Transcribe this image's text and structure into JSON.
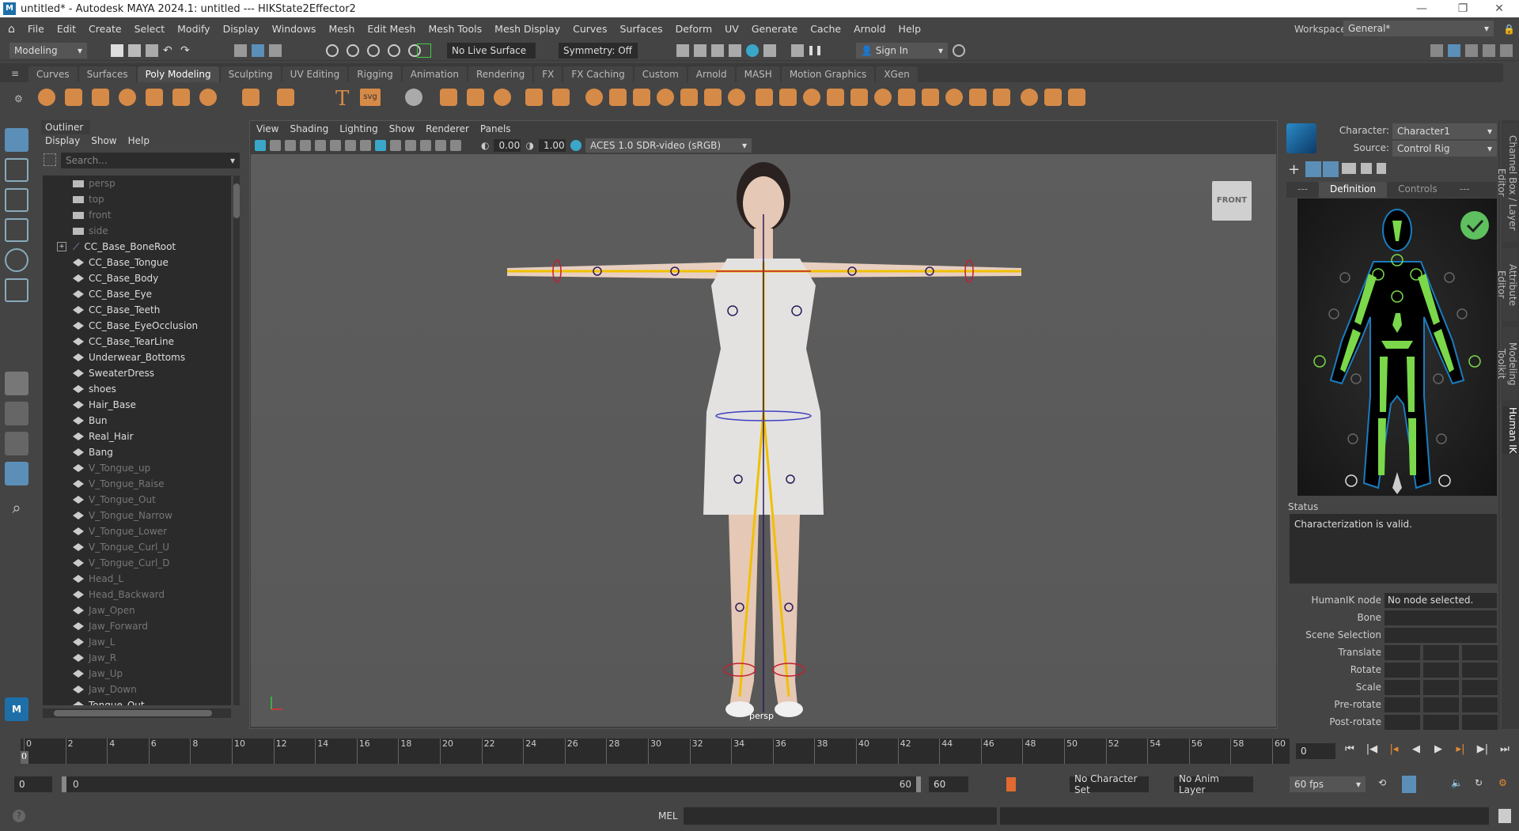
{
  "window": {
    "title": "untitled* - Autodesk MAYA 2024.1: untitled   ---   HIKState2Effector2",
    "logo": "M"
  },
  "menus": [
    "File",
    "Edit",
    "Create",
    "Select",
    "Modify",
    "Display",
    "Windows",
    "Mesh",
    "Edit Mesh",
    "Mesh Tools",
    "Mesh Display",
    "Curves",
    "Surfaces",
    "Deform",
    "UV",
    "Generate",
    "Cache",
    "Arnold",
    "Help"
  ],
  "workspace": {
    "label": "Workspace:",
    "value": "General*"
  },
  "statusline": {
    "mode": "Modeling",
    "live_surface": "No Live Surface",
    "symmetry": "Symmetry: Off",
    "sign_in": "Sign In"
  },
  "shelf_tabs": [
    "Curves",
    "Surfaces",
    "Poly Modeling",
    "Sculpting",
    "UV Editing",
    "Rigging",
    "Animation",
    "Rendering",
    "FX",
    "FX Caching",
    "Custom",
    "Arnold",
    "MASH",
    "Motion Graphics",
    "XGen"
  ],
  "shelf_active": "Poly Modeling",
  "shelf_text_icons": {
    "text_tool": "T",
    "svg_tool": "svg"
  },
  "outliner": {
    "title": "Outliner",
    "menus": [
      "Display",
      "Show",
      "Help"
    ],
    "search_placeholder": "Search...",
    "items": [
      {
        "name": "persp",
        "type": "camera",
        "dim": true
      },
      {
        "name": "top",
        "type": "camera",
        "dim": true
      },
      {
        "name": "front",
        "type": "camera",
        "dim": true
      },
      {
        "name": "side",
        "type": "camera",
        "dim": true
      },
      {
        "name": "CC_Base_BoneRoot",
        "type": "joint",
        "dim": false
      },
      {
        "name": "CC_Base_Tongue",
        "type": "mesh",
        "dim": false
      },
      {
        "name": "CC_Base_Body",
        "type": "mesh",
        "dim": false
      },
      {
        "name": "CC_Base_Eye",
        "type": "mesh",
        "dim": false
      },
      {
        "name": "CC_Base_Teeth",
        "type": "mesh",
        "dim": false
      },
      {
        "name": "CC_Base_EyeOcclusion",
        "type": "mesh",
        "dim": false
      },
      {
        "name": "CC_Base_TearLine",
        "type": "mesh",
        "dim": false
      },
      {
        "name": "Underwear_Bottoms",
        "type": "mesh",
        "dim": false
      },
      {
        "name": "SweaterDress",
        "type": "mesh",
        "dim": false
      },
      {
        "name": "shoes",
        "type": "mesh",
        "dim": false
      },
      {
        "name": "Hair_Base",
        "type": "mesh",
        "dim": false
      },
      {
        "name": "Bun",
        "type": "mesh",
        "dim": false
      },
      {
        "name": "Real_Hair",
        "type": "mesh",
        "dim": false
      },
      {
        "name": "Bang",
        "type": "mesh",
        "dim": false
      },
      {
        "name": "V_Tongue_up",
        "type": "mesh",
        "dim": true
      },
      {
        "name": "V_Tongue_Raise",
        "type": "mesh",
        "dim": true
      },
      {
        "name": "V_Tongue_Out",
        "type": "mesh",
        "dim": true
      },
      {
        "name": "V_Tongue_Narrow",
        "type": "mesh",
        "dim": true
      },
      {
        "name": "V_Tongue_Lower",
        "type": "mesh",
        "dim": true
      },
      {
        "name": "V_Tongue_Curl_U",
        "type": "mesh",
        "dim": true
      },
      {
        "name": "V_Tongue_Curl_D",
        "type": "mesh",
        "dim": true
      },
      {
        "name": "Head_L",
        "type": "mesh",
        "dim": true
      },
      {
        "name": "Head_Backward",
        "type": "mesh",
        "dim": true
      },
      {
        "name": "Jaw_Open",
        "type": "mesh",
        "dim": true
      },
      {
        "name": "Jaw_Forward",
        "type": "mesh",
        "dim": true
      },
      {
        "name": "Jaw_L",
        "type": "mesh",
        "dim": true
      },
      {
        "name": "Jaw_R",
        "type": "mesh",
        "dim": true
      },
      {
        "name": "Jaw_Up",
        "type": "mesh",
        "dim": true
      },
      {
        "name": "Jaw_Down",
        "type": "mesh",
        "dim": true
      },
      {
        "name": "Tongue_Out",
        "type": "mesh",
        "dim": false
      }
    ]
  },
  "viewport": {
    "menus": [
      "View",
      "Shading",
      "Lighting",
      "Show",
      "Renderer",
      "Panels"
    ],
    "exposure": "0.00",
    "gamma": "1.00",
    "color_space": "ACES 1.0 SDR-video (sRGB)",
    "view_cube": "FRONT",
    "camera_label": "persp"
  },
  "humanik": {
    "character_label": "Character:",
    "character": "Character1",
    "source_label": "Source:",
    "source": "Control Rig",
    "tabs": [
      "---",
      "Definition",
      "Controls",
      "---"
    ],
    "active_tab": "Definition",
    "status_label": "Status",
    "status_text": "Characterization is valid.",
    "fields": [
      {
        "label": "HumanIK node",
        "value": "No node selected."
      },
      {
        "label": "Bone",
        "value": ""
      },
      {
        "label": "Scene Selection",
        "value": ""
      }
    ],
    "vector_fields": [
      "Translate",
      "Rotate",
      "Scale",
      "Pre-rotate",
      "Post-rotate"
    ]
  },
  "side_tabs": [
    "Channel Box / Layer Editor",
    "Attribute Editor",
    "Modeling Toolkit",
    "Human IK"
  ],
  "timeline": {
    "start": 0,
    "end": 60,
    "step": 2,
    "current_frame": "0",
    "current_frame_marker": "0"
  },
  "range": {
    "start": "0",
    "inner_start": "0",
    "inner_end": "60",
    "end": "60",
    "character_set": "No Character Set",
    "anim_layer": "No Anim Layer",
    "fps": "60 fps"
  },
  "command": {
    "lang": "MEL",
    "help": "?"
  }
}
